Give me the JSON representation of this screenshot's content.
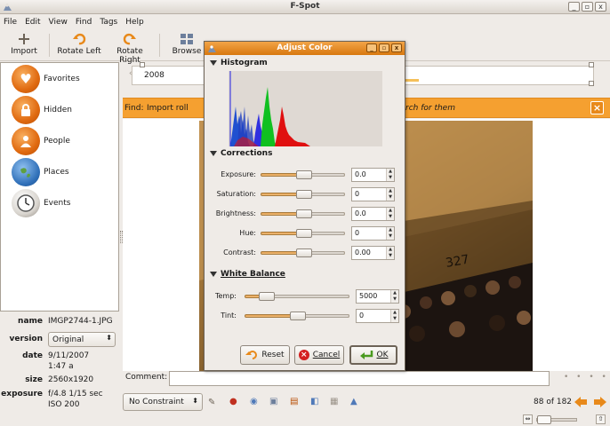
{
  "window": {
    "title": "F-Spot",
    "controls": [
      "_",
      "▫",
      "x"
    ]
  },
  "menu": [
    "File",
    "Edit",
    "View",
    "Find",
    "Tags",
    "Help"
  ],
  "toolbar": {
    "import": "Import",
    "rotate_left": "Rotate Left",
    "rotate_right": "Rotate Right",
    "browse": "Browse"
  },
  "tags": [
    "Favorites",
    "Hidden",
    "People",
    "Places",
    "Events"
  ],
  "timeline": {
    "year": "2008"
  },
  "findbar": {
    "label": "Find:",
    "query": "Import roll",
    "hint": "rch for them"
  },
  "info": {
    "name": {
      "label": "name",
      "value": "IMGP2744-1.JPG"
    },
    "version": {
      "label": "version",
      "value": "Original"
    },
    "date": {
      "label": "date",
      "value": "9/11/2007",
      "time": "1:47 a"
    },
    "size": {
      "label": "size",
      "value": "2560x1920"
    },
    "exposure": {
      "label": "exposure",
      "value": "f/4.8 1/15 sec",
      "iso": "ISO 200"
    }
  },
  "comment_label": "Comment:",
  "bottom": {
    "constraint": "No Constraint",
    "count": "88 of 182"
  },
  "dialog": {
    "title": "Adjust Color",
    "histogram_label": "Histogram",
    "corrections_label": "Corrections",
    "corrections": [
      {
        "label": "Exposure:",
        "value": "0.0",
        "level": 0.5
      },
      {
        "label": "Saturation:",
        "value": "0",
        "level": 0.5
      },
      {
        "label": "Brightness:",
        "value": "0.0",
        "level": 0.5
      },
      {
        "label": "Hue:",
        "value": "0",
        "level": 0.5
      },
      {
        "label": "Contrast:",
        "value": "0.00",
        "level": 0.5
      }
    ],
    "white_balance_label": "White Balance",
    "white_balance": [
      {
        "label": "Temp:",
        "value": "5000",
        "level": 0.2
      },
      {
        "label": "Tint:",
        "value": "0",
        "level": 0.5
      }
    ],
    "buttons": {
      "reset": "Reset",
      "cancel": "Cancel",
      "ok": "OK"
    }
  },
  "colors": {
    "accent": "#f5a030",
    "title_orange": "#d8780f"
  }
}
